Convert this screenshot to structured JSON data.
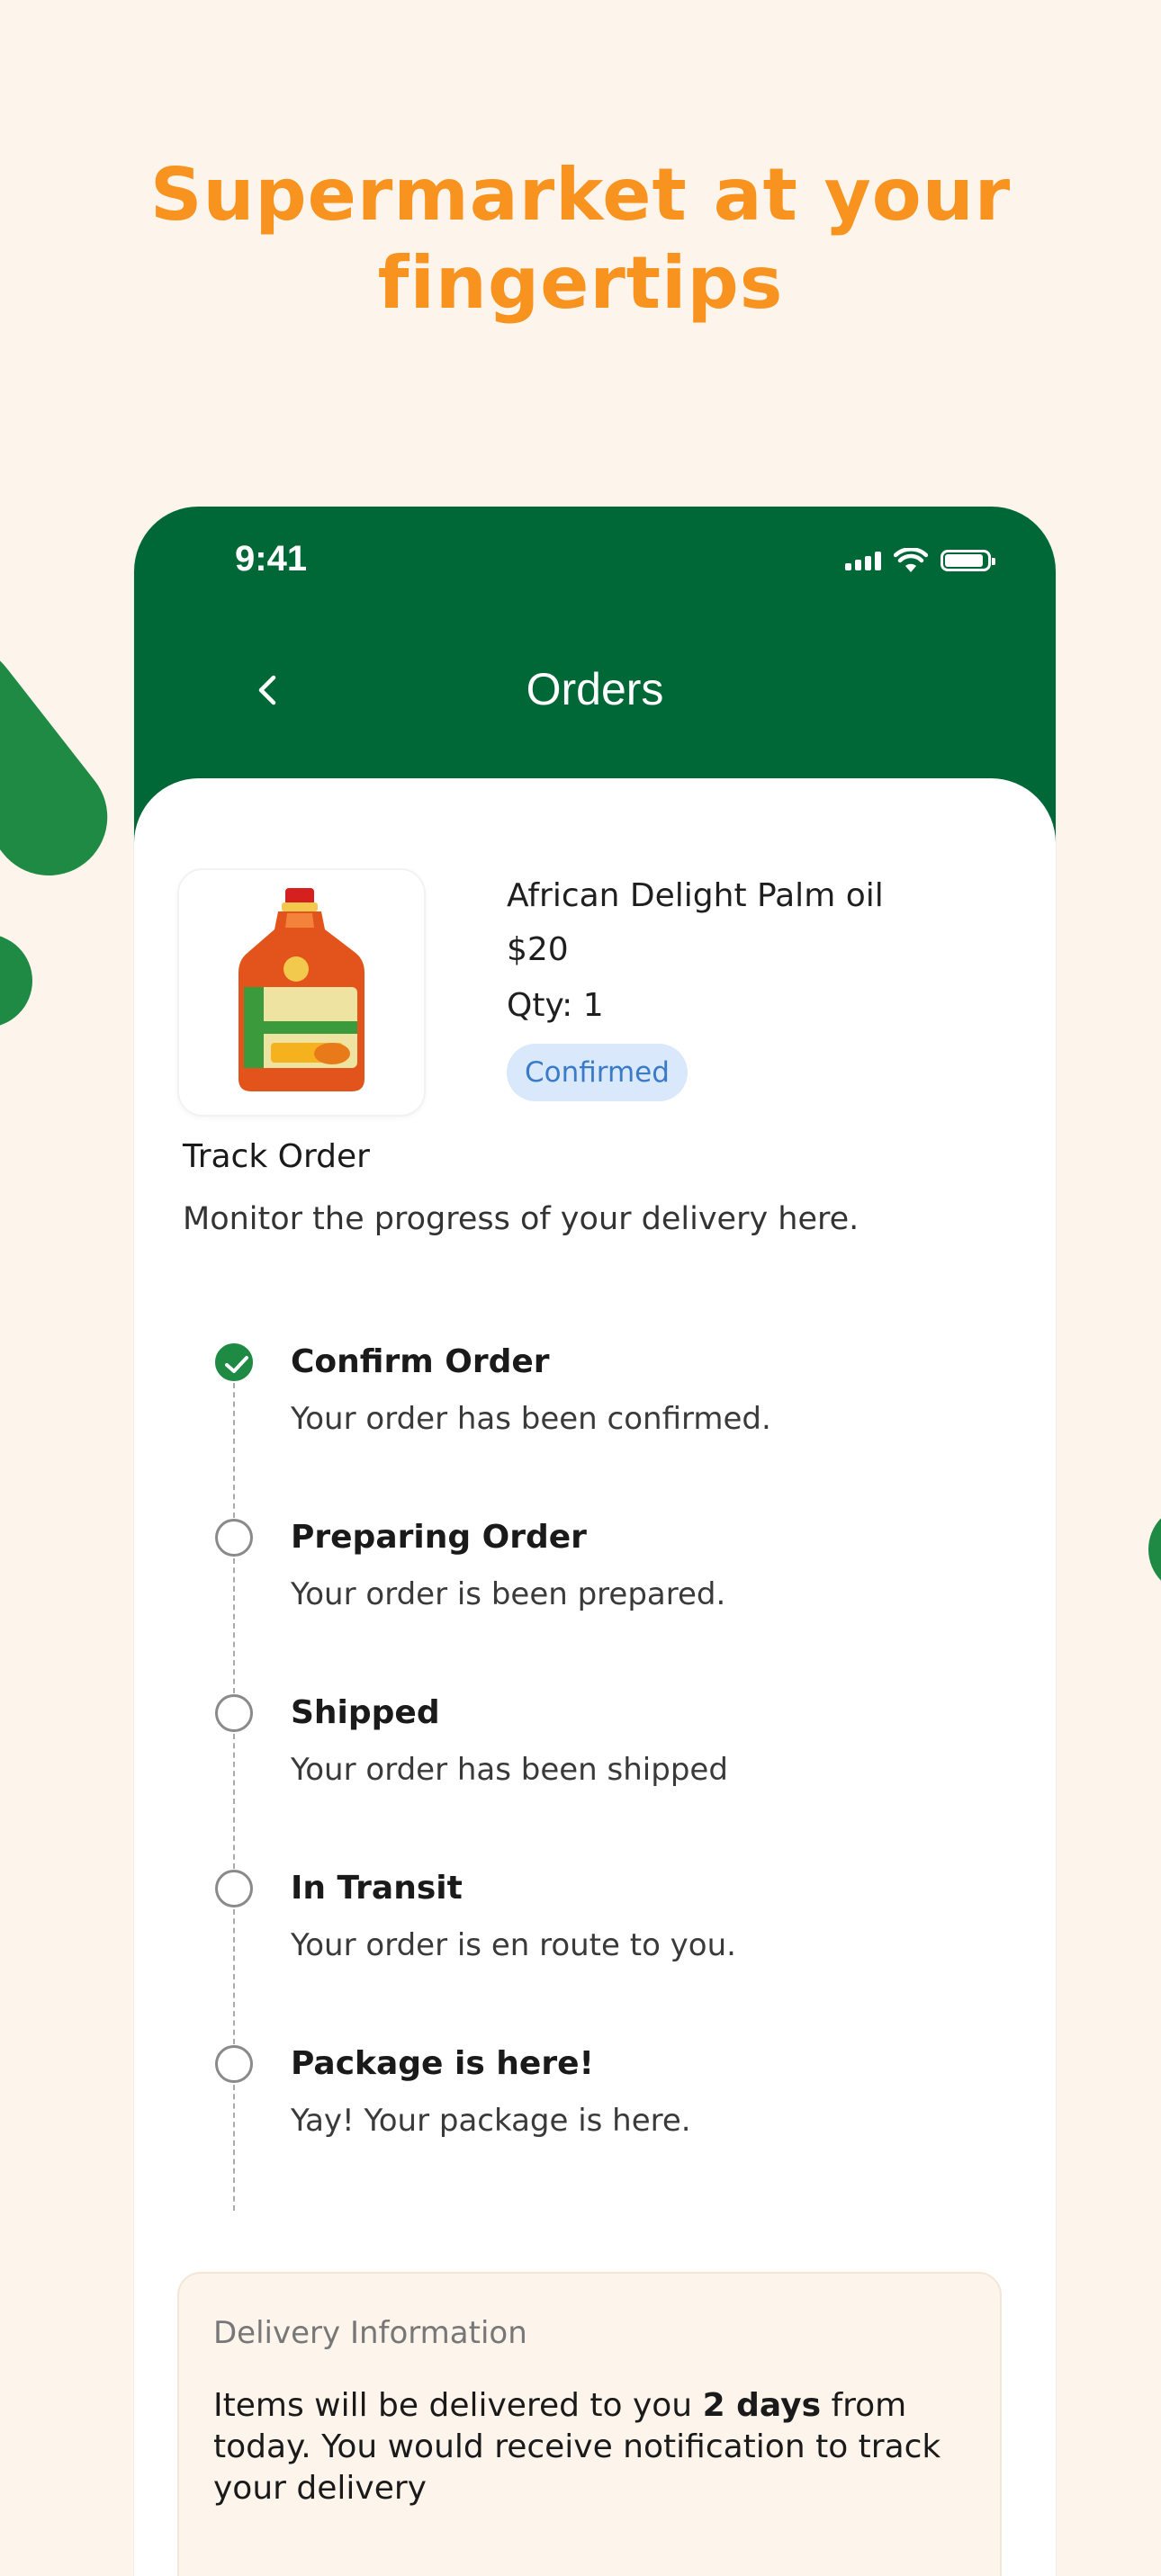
{
  "headline": {
    "line1": "Supermarket at your",
    "line2": "fingertips"
  },
  "status_bar": {
    "time": "9:41"
  },
  "nav": {
    "title": "Orders"
  },
  "product": {
    "name": "African Delight Palm oil",
    "price": "$20",
    "qty": "Qty: 1",
    "status": "Confirmed",
    "image": "palm-oil-bottle-icon"
  },
  "track": {
    "title": "Track Order",
    "subtitle": "Monitor the progress of your delivery here.",
    "steps": [
      {
        "title": "Confirm Order",
        "desc": "Your order has been confirmed.",
        "done": true
      },
      {
        "title": "Preparing Order",
        "desc": "Your order is been prepared.",
        "done": false
      },
      {
        "title": "Shipped",
        "desc": "Your order has been shipped",
        "done": false
      },
      {
        "title": "In Transit",
        "desc": "Your order is en route to you.",
        "done": false
      },
      {
        "title": "Package is here!",
        "desc": "Yay! Your package is here.",
        "done": false
      }
    ]
  },
  "delivery": {
    "title": "Delivery Information",
    "text_before": "Items will be delivered to you ",
    "text_bold": "2 days",
    "text_after": " from today. You would receive notification to track your delivery"
  },
  "colors": {
    "brand_green": "#006837",
    "accent_orange": "#F7931E",
    "badge_bg": "#D9E8FB",
    "badge_text": "#3A7BC8",
    "page_bg": "#FDF5EC"
  }
}
